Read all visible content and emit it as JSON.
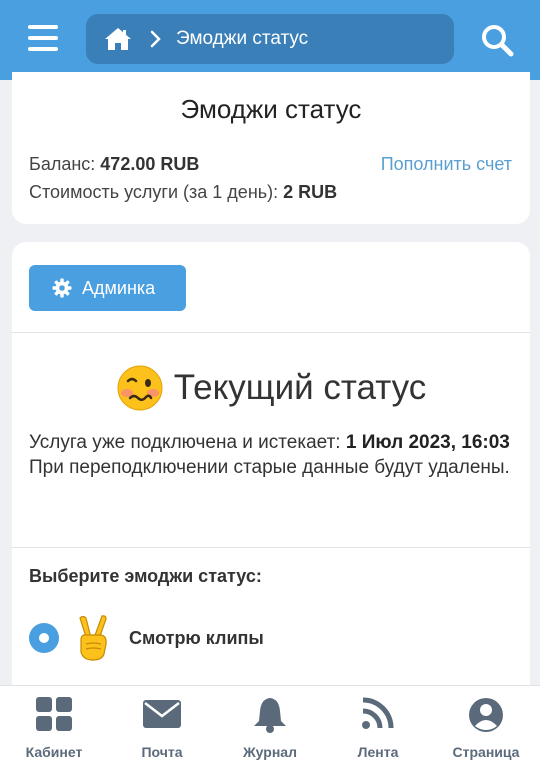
{
  "header": {
    "breadcrumb_label": "Эмоджи статус",
    "icons": [
      "menu-icon",
      "home-icon",
      "chevron-right-icon",
      "search-icon"
    ]
  },
  "summary": {
    "title": "Эмоджи статус",
    "balance_label": "Баланс:",
    "balance_value": "472.00 RUB",
    "topup_link": "Пополнить счет",
    "cost_label": "Стоимость услуги (за 1 день):",
    "cost_value": "2 RUB"
  },
  "main": {
    "admin_button": "Админка",
    "status_title": "Текущий статус",
    "status_emoji": "woozy-face",
    "subscription_text": "Услуга уже подключена и истекает:",
    "expiry_date": "1 Июл 2023, 16:03",
    "reconnect_note": "При переподключении старые данные будут удалены.",
    "choose_label": "Выберите эмоджи статус:",
    "options": [
      {
        "label": "Смотрю клипы",
        "emoji": "victory-hand",
        "selected": true
      }
    ]
  },
  "bottom_nav": [
    {
      "label": "Кабинет",
      "icon": "grid-icon"
    },
    {
      "label": "Почта",
      "icon": "envelope-icon"
    },
    {
      "label": "Журнал",
      "icon": "bell-icon"
    },
    {
      "label": "Лента",
      "icon": "rss-icon"
    },
    {
      "label": "Страница",
      "icon": "user-circle-icon"
    }
  ],
  "colors": {
    "accent": "#4a9fe0",
    "breadcrumb_bg": "#3b7fb8",
    "link": "#5a9fd0",
    "nav_icon": "#5b6a7b"
  }
}
